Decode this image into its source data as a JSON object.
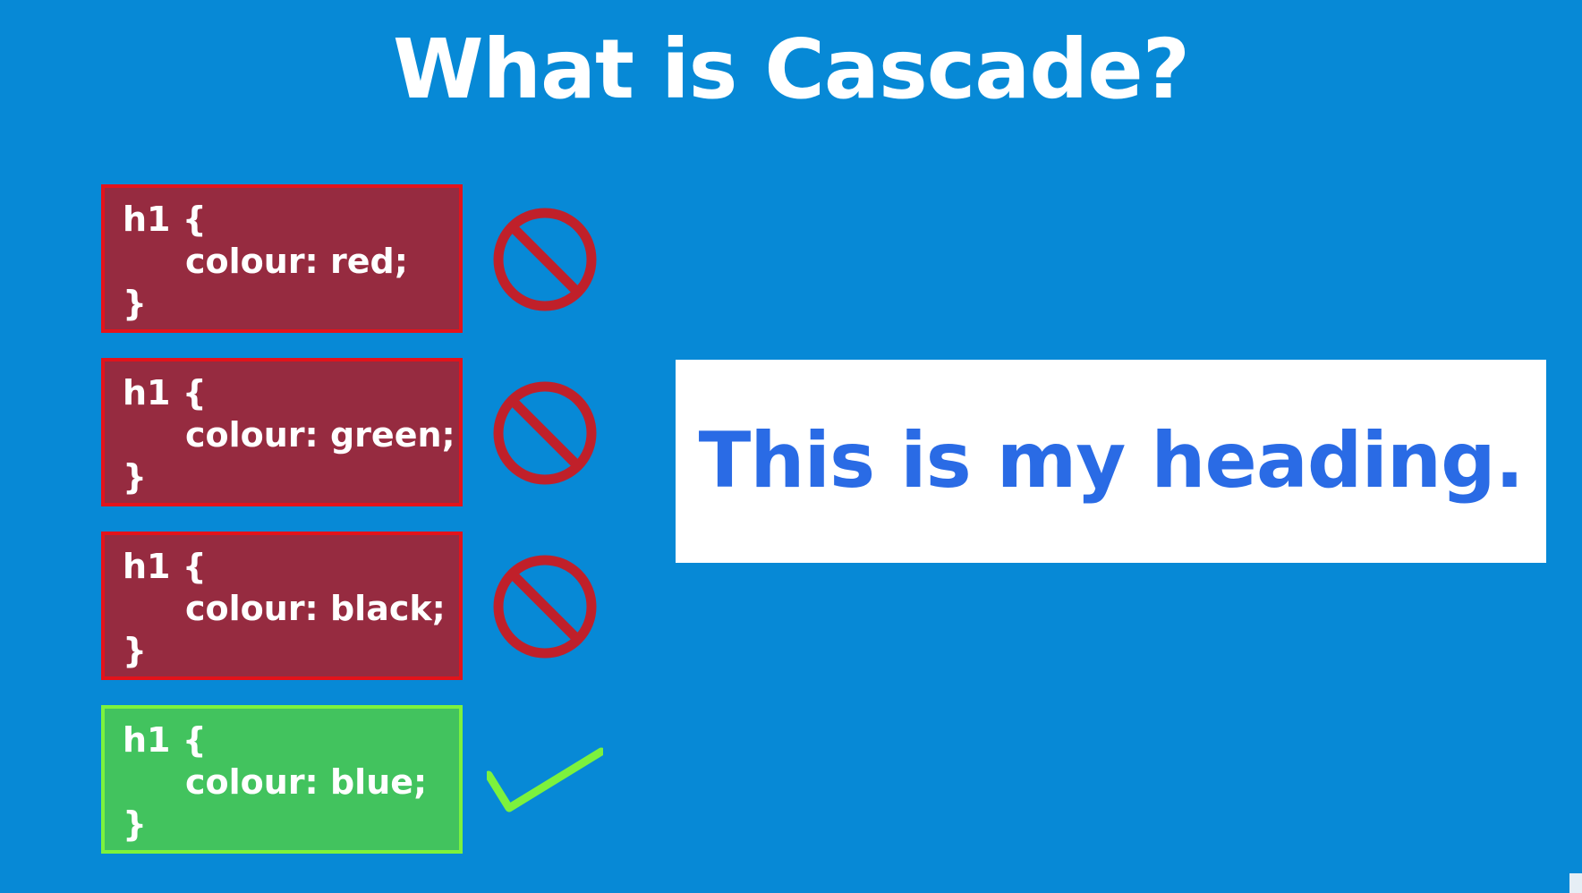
{
  "slide": {
    "title": "What is Cascade?"
  },
  "rules": [
    {
      "selector": "h1 {",
      "declaration": "colour: red;",
      "close": "}",
      "status": "overridden",
      "marker_icon": "prohibited-icon"
    },
    {
      "selector": "h1 {",
      "declaration": "colour: green;",
      "close": "}",
      "status": "overridden",
      "marker_icon": "prohibited-icon"
    },
    {
      "selector": "h1 {",
      "declaration": "colour: black;",
      "close": "}",
      "status": "overridden",
      "marker_icon": "prohibited-icon"
    },
    {
      "selector": "h1 {",
      "declaration": "colour: blue;",
      "close": "}",
      "status": "applied",
      "marker_icon": "check-icon"
    }
  ],
  "preview": {
    "heading": "This is my heading."
  },
  "colors": {
    "background": "#0789d6",
    "overridden_fill": "#962b40",
    "overridden_border": "#e3131b",
    "applied_fill": "#42c35e",
    "applied_border": "#7cf23d",
    "prohibited_mark": "#c0202a",
    "check_mark": "#7cf23d",
    "heading_text": "#2a6be5"
  }
}
